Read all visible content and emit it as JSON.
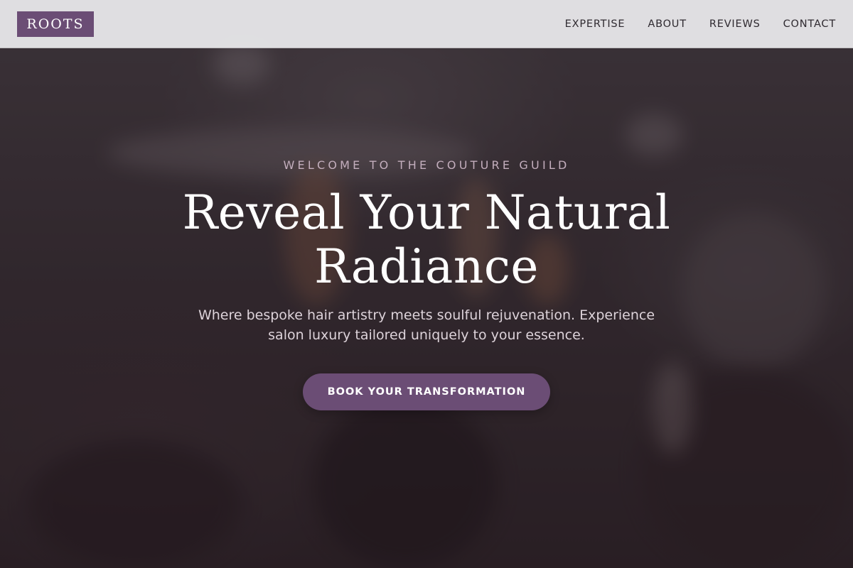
{
  "header": {
    "logo": "ROOTS",
    "nav": [
      {
        "label": "EXPERTISE"
      },
      {
        "label": "ABOUT"
      },
      {
        "label": "REVIEWS"
      },
      {
        "label": "CONTACT"
      }
    ]
  },
  "hero": {
    "eyebrow": "WELCOME TO THE COUTURE GUILD",
    "headline_line1": "Reveal Your Natural",
    "headline_line2": "Radiance",
    "subtext": "Where bespoke hair artistry meets soulful rejuvenation. Experience salon luxury tailored uniquely to your essence.",
    "cta_label": "BOOK YOUR TRANSFORMATION",
    "background_image": "makeup-brushes-photo"
  },
  "colors": {
    "brand_purple": "#6b4d75",
    "header_bg": "#ececee",
    "hero_overlay": "#261a21",
    "eyebrow_text": "#c3aebd"
  }
}
